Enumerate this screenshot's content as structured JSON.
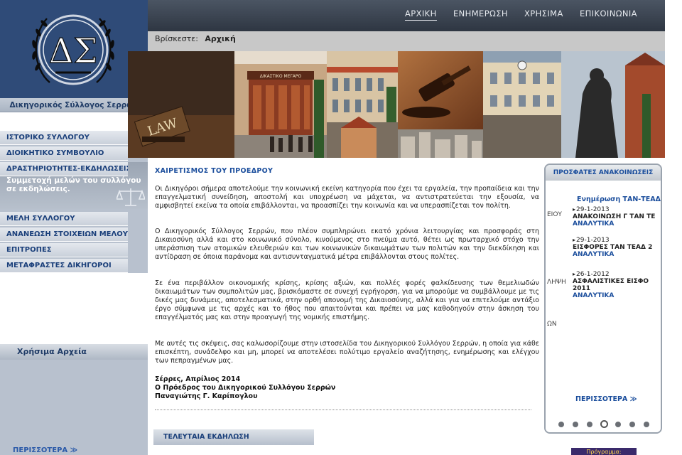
{
  "org": {
    "name": "Δικηγορικός Σύλλογος Σερρών",
    "logo_letters": "ΔΣ"
  },
  "topnav": {
    "items": [
      {
        "label": "ΑΡΧΙΚΗ",
        "active": true
      },
      {
        "label": "ΕΝΗΜΕΡΩΣΗ",
        "active": false
      },
      {
        "label": "ΧΡΗΣΙΜΑ",
        "active": false
      },
      {
        "label": "ΕΠΙΚΟΙΝΩΝΙΑ",
        "active": false
      }
    ]
  },
  "breadcrumb": {
    "prefix": "Βρίσκεστε:",
    "current": "Αρχική"
  },
  "banner": {
    "sign_law": "LAW",
    "sign_building": "ΔΙΚΑΣΤΙΚΟ ΜΕΓΑΡΟ"
  },
  "sidebar": {
    "items": [
      "ΙΣΤΟΡΙΚΟ ΣΥΛΛΟΓΟΥ",
      "ΔΙΟΙΚΗΤΙΚΟ ΣΥΜΒΟΥΛΙΟ",
      "ΔΡΑΣΤΗΡΙΟΤΗΤΕΣ-ΕΚΔΗΛΩΣΕΙΣ",
      "ΜΕΛΗ ΣΥΛΛΟΓΟΥ",
      "ΑΝΑΝΕΩΣΗ ΣΤΟΙΧΕΙΩΝ ΜΕΛΟΥΣ",
      "ΕΠΙΤΡΟΠΕΣ",
      "ΜΕΤΑΦΡΑΣΤΕΣ ΔΙΚΗΓΟΡΟΙ"
    ],
    "feature_text": "Συμμετοχή μελών του συλλόγου σε εκδηλώσεις.",
    "files_heading": "Χρήσιμα Αρχεία",
    "more_label": "ΠΕΡΙΣΣΟΤΕΡΑ ≫"
  },
  "article": {
    "title": "ΧΑΙΡΕΤΙΣΜΟΣ ΤΟΥ ΠΡΟΕΔΡΟΥ",
    "paragraphs": [
      "Οι Δικηγόροι σήμερα αποτελούμε την κοινωνική εκείνη κατηγορία που έχει τα εργαλεία, την προπαίδεια και την επαγγελματική συνείδηση, αποστολή και υποχρέωση να μάχεται, να αντιστρατεύεται την εξουσία, να αμφισβητεί εκείνα τα οποία επιβάλλονται, να προασπίζει την κοινωνία και να υπερασπίζεται τον πολίτη.",
      "Ο Δικηγορικός Σύλλογος Σερρών, που πλέον συμπληρώνει εκατό χρόνια λειτουργίας και προσφοράς στη Δικαιοσύνη αλλά και στο κοινωνικό σύνολο, κινούμενος στο πνεύμα αυτό, θέτει ως πρωταρχικό στόχο την υπεράσπιση των ατομικών ελευθεριών και των κοινωνικών δικαιωμάτων των πολιτών και την διεκδίκηση και αντίδραση σε όποια παράνομα και αντισυνταγματικά μέτρα επιβάλλονται στους πολίτες.",
      "Σε ένα περιβάλλον οικονομικής κρίσης, κρίσης αξιών, και πολλές φορές φαλκίδευσης των θεμελιωδών δικαιωμάτων των συμπολιτών μας, βρισκόμαστε σε συνεχή εγρήγορση, για να μπορούμε να συμβάλλουμε με τις δικές μας δυνάμεις, αποτελεσματικά, στην ορθή απονομή της Δικαιοσύνης, αλλά και για να επιτελούμε αντάξιο έργο σύμφωνα με τις αρχές και το ήθος που απαιτούνται και πρέπει να μας καθοδηγούν στην άσκηση του επαγγέλματός μας και στην προαγωγή της νομικής επιστήμης.",
      "Με αυτές τις σκέψεις, σας καλωσορίζουμε στην ιστοσελίδα του Δικηγορικού Συλλόγου Σερρών, η οποία για κάθε επισκέπτη, συνάδελφο και μη, μπορεί να αποτελέσει πολύτιμο εργαλείο αναζήτησης, ενημέρωσης και ελέγχου των πεπραγμένων μας."
    ],
    "signature": [
      "Σέρρες, Απρίλιος 2014",
      "Ο Πρόεδρος του Δικηγορικού Συλλόγου Σερρών",
      "Παναγιώτης Γ. Καρίπογλου"
    ]
  },
  "last_event": {
    "heading": "ΤΕΛΕΥΤΑΙΑ ΕΚΔΗΛΩΣΗ"
  },
  "announcements": {
    "heading": "ΠΡΟΣΦΑΤΕΣ ΑΝΑΚΟΙΝΩΣΕΙΣ",
    "subtitle": "Ενημέρωση ΤΑΝ-ΤΕΑΔ",
    "ghost_texts": [
      "ΕΙΟΥ",
      "ΛΗΨΗ",
      "ΩΝ"
    ],
    "items": [
      {
        "date": "29-1-2013",
        "title": "ΑΝΑΚΟΙΝΩΣΗ Γ ΤΑΝ ΤΕ",
        "link": "ΑΝΑΛΥΤΙΚΑ"
      },
      {
        "date": "29-1-2013",
        "title": "ΕΙΣΦΟΡΕΣ ΤΑΝ ΤΕΑΔ 2",
        "link": "ΑΝΑΛΥΤΙΚΑ"
      },
      {
        "date": "26-1-2012",
        "title": "ΑΣΦΑΛΙΣΤΙΚΕΣ ΕΙΣΦΟ",
        "title2": "2011",
        "link": "ΑΝΑΛΥΤΙΚΑ"
      }
    ],
    "more_label": "ΠΕΡΙΣΣΟΤΕΡΑ ≫",
    "pager": {
      "count": 7,
      "active_index": 3
    }
  },
  "badge": {
    "label": "Πρόγραμμα:"
  },
  "colors": {
    "accent": "#1a4d9c",
    "logo_bg": "#2f4b78",
    "nav_bg": "#3a4350"
  }
}
